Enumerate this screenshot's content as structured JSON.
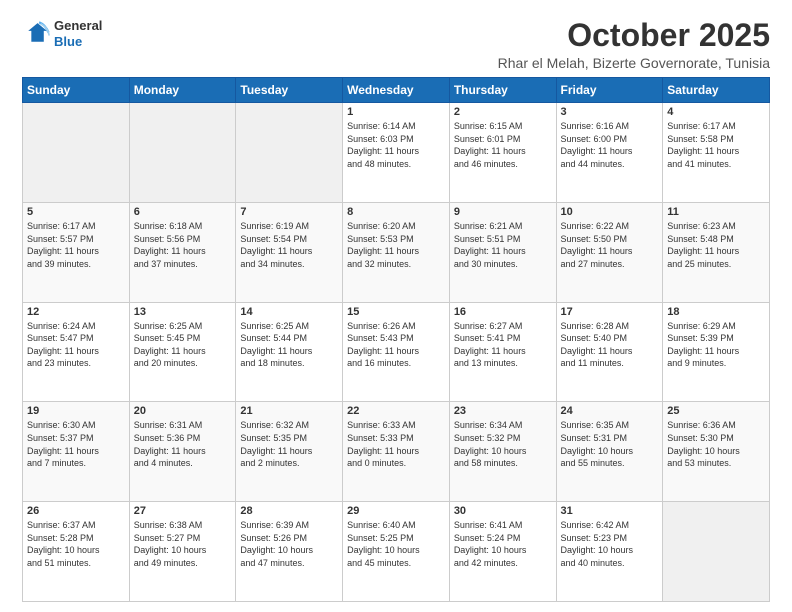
{
  "header": {
    "logo_line1": "General",
    "logo_line2": "Blue",
    "title": "October 2025",
    "subtitle": "Rhar el Melah, Bizerte Governorate, Tunisia"
  },
  "calendar": {
    "days_of_week": [
      "Sunday",
      "Monday",
      "Tuesday",
      "Wednesday",
      "Thursday",
      "Friday",
      "Saturday"
    ],
    "weeks": [
      [
        {
          "day": "",
          "info": ""
        },
        {
          "day": "",
          "info": ""
        },
        {
          "day": "",
          "info": ""
        },
        {
          "day": "1",
          "info": "Sunrise: 6:14 AM\nSunset: 6:03 PM\nDaylight: 11 hours\nand 48 minutes."
        },
        {
          "day": "2",
          "info": "Sunrise: 6:15 AM\nSunset: 6:01 PM\nDaylight: 11 hours\nand 46 minutes."
        },
        {
          "day": "3",
          "info": "Sunrise: 6:16 AM\nSunset: 6:00 PM\nDaylight: 11 hours\nand 44 minutes."
        },
        {
          "day": "4",
          "info": "Sunrise: 6:17 AM\nSunset: 5:58 PM\nDaylight: 11 hours\nand 41 minutes."
        }
      ],
      [
        {
          "day": "5",
          "info": "Sunrise: 6:17 AM\nSunset: 5:57 PM\nDaylight: 11 hours\nand 39 minutes."
        },
        {
          "day": "6",
          "info": "Sunrise: 6:18 AM\nSunset: 5:56 PM\nDaylight: 11 hours\nand 37 minutes."
        },
        {
          "day": "7",
          "info": "Sunrise: 6:19 AM\nSunset: 5:54 PM\nDaylight: 11 hours\nand 34 minutes."
        },
        {
          "day": "8",
          "info": "Sunrise: 6:20 AM\nSunset: 5:53 PM\nDaylight: 11 hours\nand 32 minutes."
        },
        {
          "day": "9",
          "info": "Sunrise: 6:21 AM\nSunset: 5:51 PM\nDaylight: 11 hours\nand 30 minutes."
        },
        {
          "day": "10",
          "info": "Sunrise: 6:22 AM\nSunset: 5:50 PM\nDaylight: 11 hours\nand 27 minutes."
        },
        {
          "day": "11",
          "info": "Sunrise: 6:23 AM\nSunset: 5:48 PM\nDaylight: 11 hours\nand 25 minutes."
        }
      ],
      [
        {
          "day": "12",
          "info": "Sunrise: 6:24 AM\nSunset: 5:47 PM\nDaylight: 11 hours\nand 23 minutes."
        },
        {
          "day": "13",
          "info": "Sunrise: 6:25 AM\nSunset: 5:45 PM\nDaylight: 11 hours\nand 20 minutes."
        },
        {
          "day": "14",
          "info": "Sunrise: 6:25 AM\nSunset: 5:44 PM\nDaylight: 11 hours\nand 18 minutes."
        },
        {
          "day": "15",
          "info": "Sunrise: 6:26 AM\nSunset: 5:43 PM\nDaylight: 11 hours\nand 16 minutes."
        },
        {
          "day": "16",
          "info": "Sunrise: 6:27 AM\nSunset: 5:41 PM\nDaylight: 11 hours\nand 13 minutes."
        },
        {
          "day": "17",
          "info": "Sunrise: 6:28 AM\nSunset: 5:40 PM\nDaylight: 11 hours\nand 11 minutes."
        },
        {
          "day": "18",
          "info": "Sunrise: 6:29 AM\nSunset: 5:39 PM\nDaylight: 11 hours\nand 9 minutes."
        }
      ],
      [
        {
          "day": "19",
          "info": "Sunrise: 6:30 AM\nSunset: 5:37 PM\nDaylight: 11 hours\nand 7 minutes."
        },
        {
          "day": "20",
          "info": "Sunrise: 6:31 AM\nSunset: 5:36 PM\nDaylight: 11 hours\nand 4 minutes."
        },
        {
          "day": "21",
          "info": "Sunrise: 6:32 AM\nSunset: 5:35 PM\nDaylight: 11 hours\nand 2 minutes."
        },
        {
          "day": "22",
          "info": "Sunrise: 6:33 AM\nSunset: 5:33 PM\nDaylight: 11 hours\nand 0 minutes."
        },
        {
          "day": "23",
          "info": "Sunrise: 6:34 AM\nSunset: 5:32 PM\nDaylight: 10 hours\nand 58 minutes."
        },
        {
          "day": "24",
          "info": "Sunrise: 6:35 AM\nSunset: 5:31 PM\nDaylight: 10 hours\nand 55 minutes."
        },
        {
          "day": "25",
          "info": "Sunrise: 6:36 AM\nSunset: 5:30 PM\nDaylight: 10 hours\nand 53 minutes."
        }
      ],
      [
        {
          "day": "26",
          "info": "Sunrise: 6:37 AM\nSunset: 5:28 PM\nDaylight: 10 hours\nand 51 minutes."
        },
        {
          "day": "27",
          "info": "Sunrise: 6:38 AM\nSunset: 5:27 PM\nDaylight: 10 hours\nand 49 minutes."
        },
        {
          "day": "28",
          "info": "Sunrise: 6:39 AM\nSunset: 5:26 PM\nDaylight: 10 hours\nand 47 minutes."
        },
        {
          "day": "29",
          "info": "Sunrise: 6:40 AM\nSunset: 5:25 PM\nDaylight: 10 hours\nand 45 minutes."
        },
        {
          "day": "30",
          "info": "Sunrise: 6:41 AM\nSunset: 5:24 PM\nDaylight: 10 hours\nand 42 minutes."
        },
        {
          "day": "31",
          "info": "Sunrise: 6:42 AM\nSunset: 5:23 PM\nDaylight: 10 hours\nand 40 minutes."
        },
        {
          "day": "",
          "info": ""
        }
      ]
    ]
  }
}
